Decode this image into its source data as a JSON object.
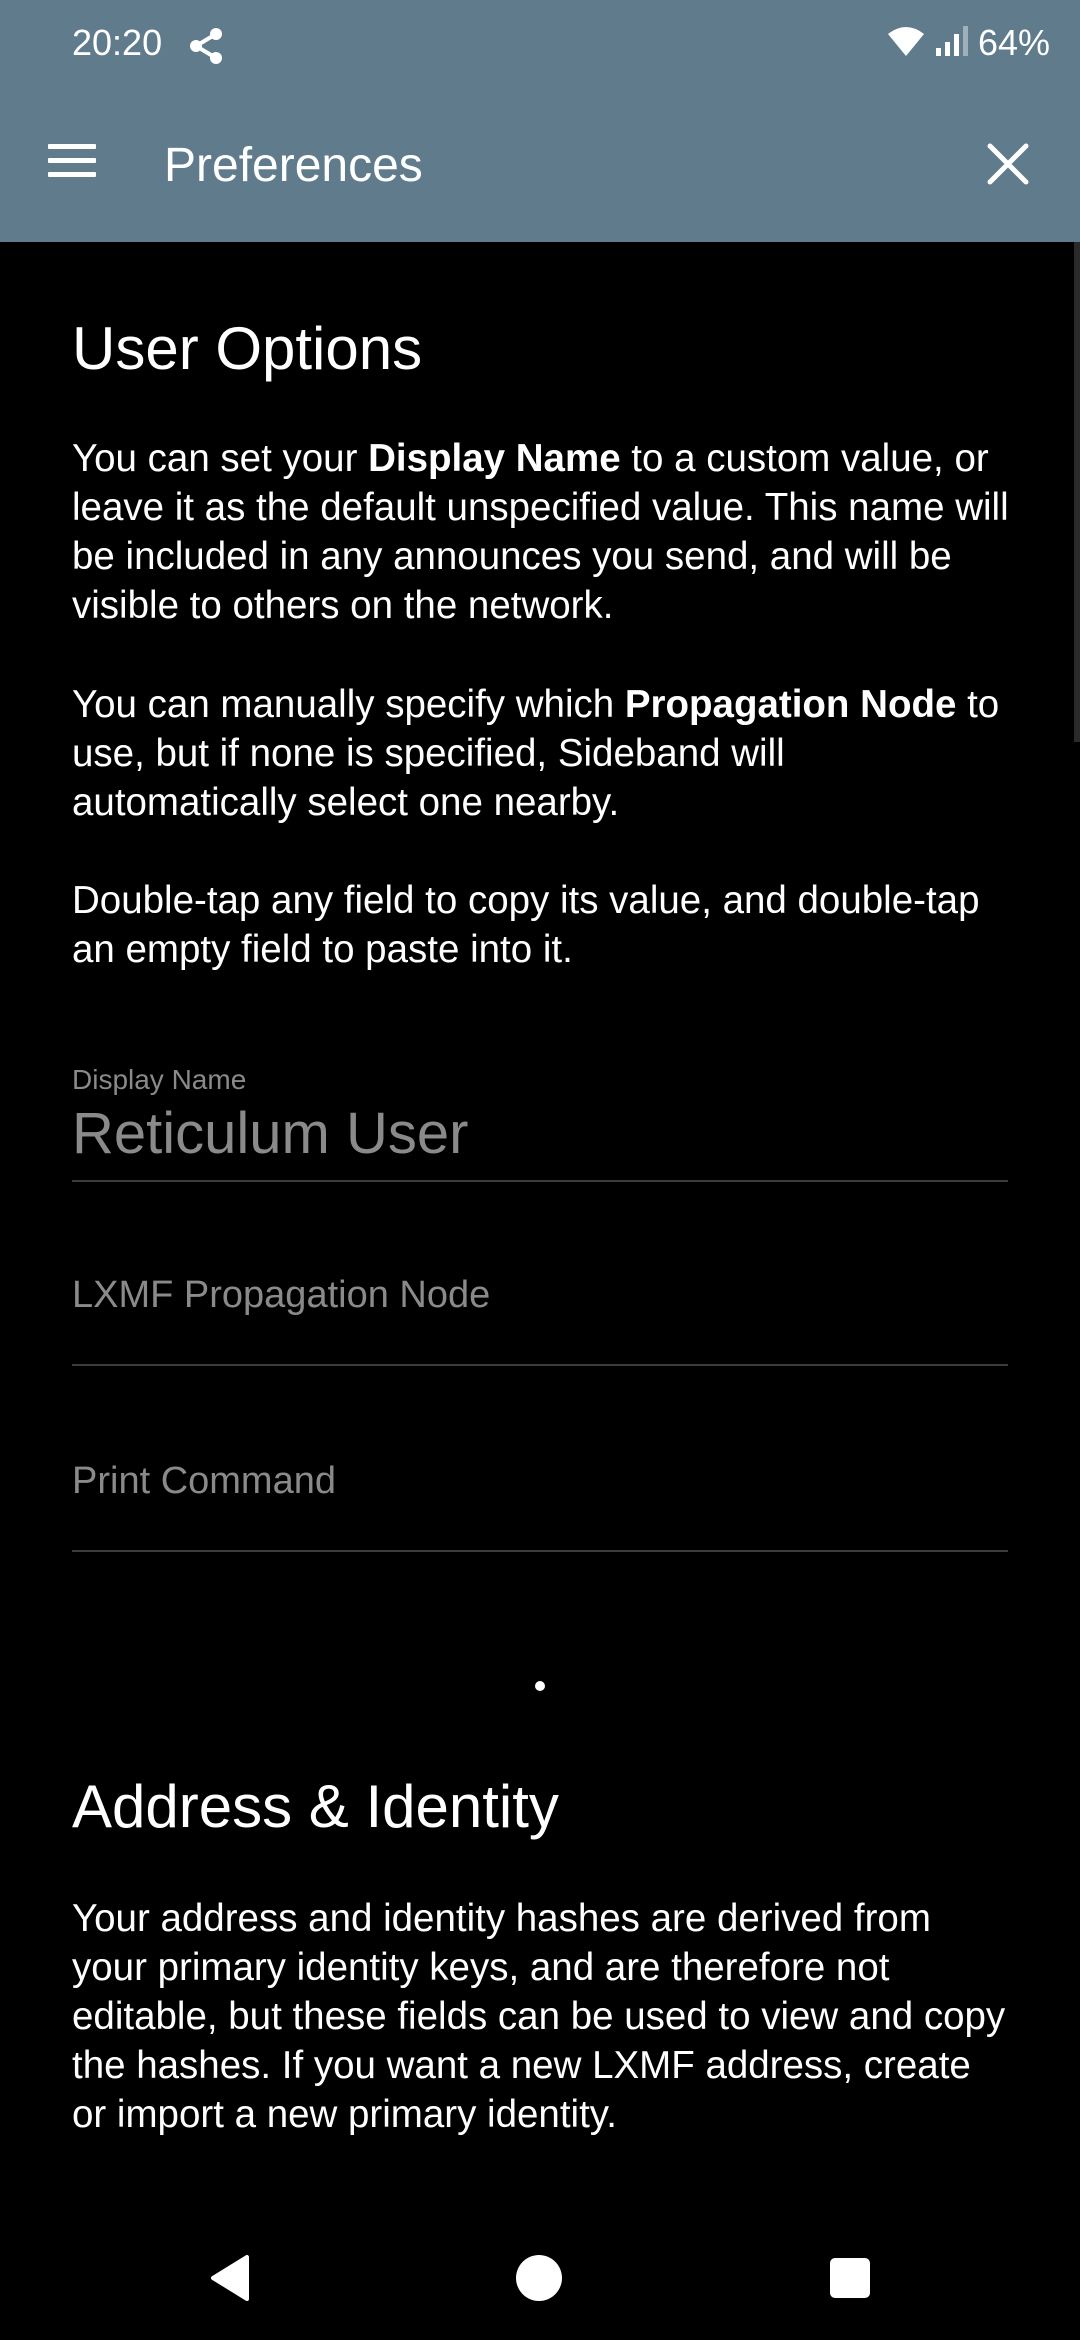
{
  "status_bar": {
    "time": "20:20",
    "battery": "64%",
    "icons": [
      "share-icon",
      "wifi-icon",
      "signal-icon"
    ]
  },
  "app_bar": {
    "title": "Preferences",
    "menu_icon": "hamburger-menu-icon",
    "close_icon": "close-icon",
    "background": "#5f7b8c"
  },
  "user_options": {
    "heading": "User Options",
    "para1": {
      "pre": "You can set your ",
      "bold": "Display Name",
      "post": " to a custom value, or leave it as the default unspecified value. This name will be included in any announces you send, and will be visible to others on the network."
    },
    "para2": {
      "pre": "You can manually specify which ",
      "bold": "Propagation Node",
      "post": " to use, but if none is specified, Sideband will automatically select one nearby."
    },
    "para3": "Double-tap any field to copy its value, and double-tap an empty field to paste into it.",
    "fields": {
      "display_name": {
        "label": "Display Name",
        "value": "Reticulum User"
      },
      "propagation_node": {
        "placeholder": "LXMF Propagation Node"
      },
      "print_command": {
        "placeholder": "Print Command"
      }
    }
  },
  "address_identity": {
    "heading": "Address & Identity",
    "para": "Your address and identity hashes are derived from your primary identity keys, and are therefore not editable, but these fields can be used to view and copy the hashes. If you want a new LXMF address, create or import a new primary identity."
  },
  "nav_bar": {
    "icons": [
      "back-icon",
      "home-icon",
      "recents-icon"
    ]
  }
}
